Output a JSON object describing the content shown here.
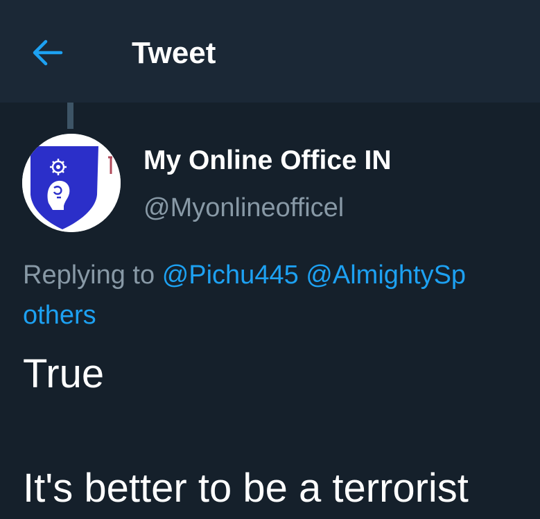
{
  "header": {
    "title": "Tweet",
    "back_icon": "arrow-left-icon"
  },
  "author": {
    "display_name": "My Online Office IN",
    "handle": "@Myonlineofficel",
    "avatar_icon": "shield-logo-icon"
  },
  "reply_context": {
    "prefix": "Replying to",
    "mentions": [
      "@Pichu445",
      "@AlmightySp"
    ],
    "others": "others"
  },
  "tweet": {
    "lines": [
      "True",
      "It's better to be a terrorist"
    ]
  },
  "colors": {
    "background": "#15202b",
    "header_bg": "#1b2836",
    "accent": "#1da1f2",
    "secondary_text": "#8899a6",
    "primary_text": "#ffffff",
    "avatar_shield": "#2b2fc9"
  }
}
